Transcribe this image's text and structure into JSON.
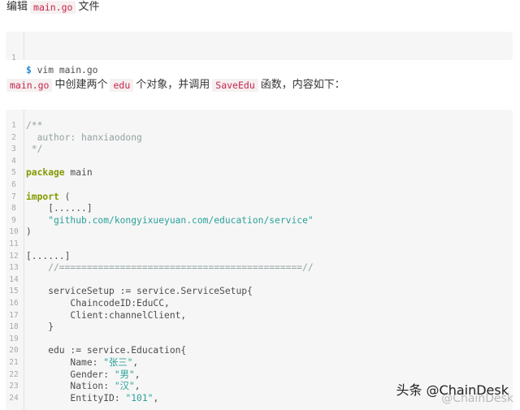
{
  "intro": {
    "p1_text": "编辑",
    "p1_code": "main.go",
    "p1_suffix": "文件",
    "p2_code1": "main.go",
    "p2_text1": "中创建两个",
    "p2_code2": "edu",
    "p2_text2": "个对象，并调用",
    "p2_code3": "SaveEdu",
    "p2_text3": "函数，内容如下："
  },
  "shell": {
    "line_number": "1",
    "prompt": "$",
    "command": " vim main.go"
  },
  "code_lines": [
    {
      "n": "1",
      "t": "/**"
    },
    {
      "n": "2",
      "t": "  author: hanxiaodong"
    },
    {
      "n": "3",
      "t": " */"
    },
    {
      "n": "4",
      "t": ""
    },
    {
      "n": "5",
      "t": "package main"
    },
    {
      "n": "6",
      "t": ""
    },
    {
      "n": "7",
      "t": "import ("
    },
    {
      "n": "8",
      "t": "    [......]"
    },
    {
      "n": "9",
      "t": "    \"github.com/kongyixueyuan.com/education/service\""
    },
    {
      "n": "10",
      "t": ")"
    },
    {
      "n": "11",
      "t": ""
    },
    {
      "n": "12",
      "t": "[......]"
    },
    {
      "n": "13",
      "t": "    //============================================//"
    },
    {
      "n": "14",
      "t": ""
    },
    {
      "n": "15",
      "t": "    serviceSetup := service.ServiceSetup{"
    },
    {
      "n": "16",
      "t": "        ChaincodeID:EduCC,"
    },
    {
      "n": "17",
      "t": "        Client:channelClient,"
    },
    {
      "n": "18",
      "t": "    }"
    },
    {
      "n": "19",
      "t": ""
    },
    {
      "n": "20",
      "t": "    edu := service.Education{"
    },
    {
      "n": "21",
      "t": "        Name: \"张三\","
    },
    {
      "n": "22",
      "t": "        Gender: \"男\","
    },
    {
      "n": "23",
      "t": "        Nation: \"汉\","
    },
    {
      "n": "24",
      "t": "        EntityID: \"101\","
    }
  ],
  "watermark": {
    "text": "头条 @ChainDesk",
    "shadow": "@ChainDesk"
  }
}
